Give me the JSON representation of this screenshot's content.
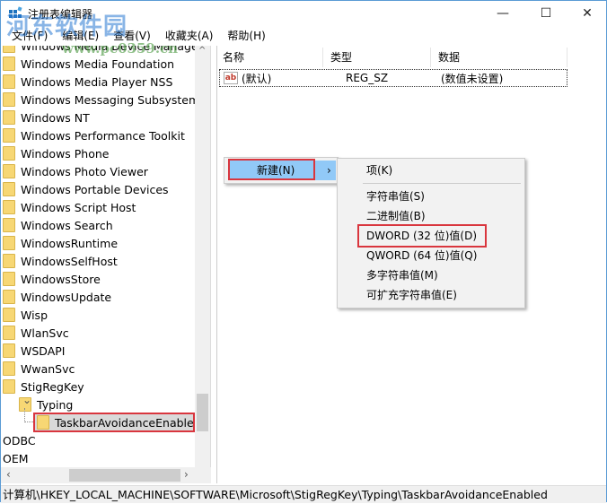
{
  "window": {
    "title": "注册表编辑器",
    "controls": {
      "minimize": "—",
      "maximize": "☐",
      "close": "✕"
    }
  },
  "watermark": {
    "text": "河东软件园",
    "url": "www.pc0359.cn"
  },
  "menubar": {
    "items": [
      "文件(F)",
      "编辑(E)",
      "查看(V)",
      "收藏夹(A)",
      "帮助(H)"
    ]
  },
  "tree": {
    "items": [
      {
        "label": "Windows Media Device Manager",
        "level": 0
      },
      {
        "label": "Windows Media Foundation",
        "level": 0
      },
      {
        "label": "Windows Media Player NSS",
        "level": 0
      },
      {
        "label": "Windows Messaging Subsystem",
        "level": 0
      },
      {
        "label": "Windows NT",
        "level": 0
      },
      {
        "label": "Windows Performance Toolkit",
        "level": 0
      },
      {
        "label": "Windows Phone",
        "level": 0
      },
      {
        "label": "Windows Photo Viewer",
        "level": 0
      },
      {
        "label": "Windows Portable Devices",
        "level": 0
      },
      {
        "label": "Windows Script Host",
        "level": 0
      },
      {
        "label": "Windows Search",
        "level": 0
      },
      {
        "label": "WindowsRuntime",
        "level": 0
      },
      {
        "label": "WindowsSelfHost",
        "level": 0
      },
      {
        "label": "WindowsStore",
        "level": 0
      },
      {
        "label": "WindowsUpdate",
        "level": 0
      },
      {
        "label": "Wisp",
        "level": 0
      },
      {
        "label": "WlanSvc",
        "level": 0
      },
      {
        "label": "WSDAPI",
        "level": 0
      },
      {
        "label": "WwanSvc",
        "level": 0
      },
      {
        "label": "StigRegKey",
        "level": 0
      },
      {
        "label": "Typing",
        "level": 1,
        "expanded": true
      },
      {
        "label": "TaskbarAvoidanceEnabled",
        "level": 2,
        "selected": true
      },
      {
        "label": "ODBC",
        "level": -1
      },
      {
        "label": "OEM",
        "level": -1
      }
    ]
  },
  "list": {
    "columns": [
      "名称",
      "类型",
      "数据"
    ],
    "rows": [
      {
        "name": "(默认)",
        "type": "REG_SZ",
        "data": "(数值未设置)",
        "icon": "string-value-icon"
      }
    ]
  },
  "context_menu": {
    "parent_item": "新建(N)",
    "submenu_arrow": "›",
    "submenu": [
      "项(K)",
      "字符串值(S)",
      "二进制值(B)",
      "DWORD (32 位)值(D)",
      "QWORD (64 位)值(Q)",
      "多字符串值(M)",
      "可扩充字符串值(E)"
    ],
    "highlighted_submenu_item": "DWORD (32 位)值(D)"
  },
  "statusbar": {
    "path": "计算机\\HKEY_LOCAL_MACHINE\\SOFTWARE\\Microsoft\\StigRegKey\\Typing\\TaskbarAvoidanceEnabled"
  },
  "colors": {
    "highlight_border": "#d9363e",
    "menu_hover": "#91c9f7",
    "folder": "#f7d774"
  }
}
